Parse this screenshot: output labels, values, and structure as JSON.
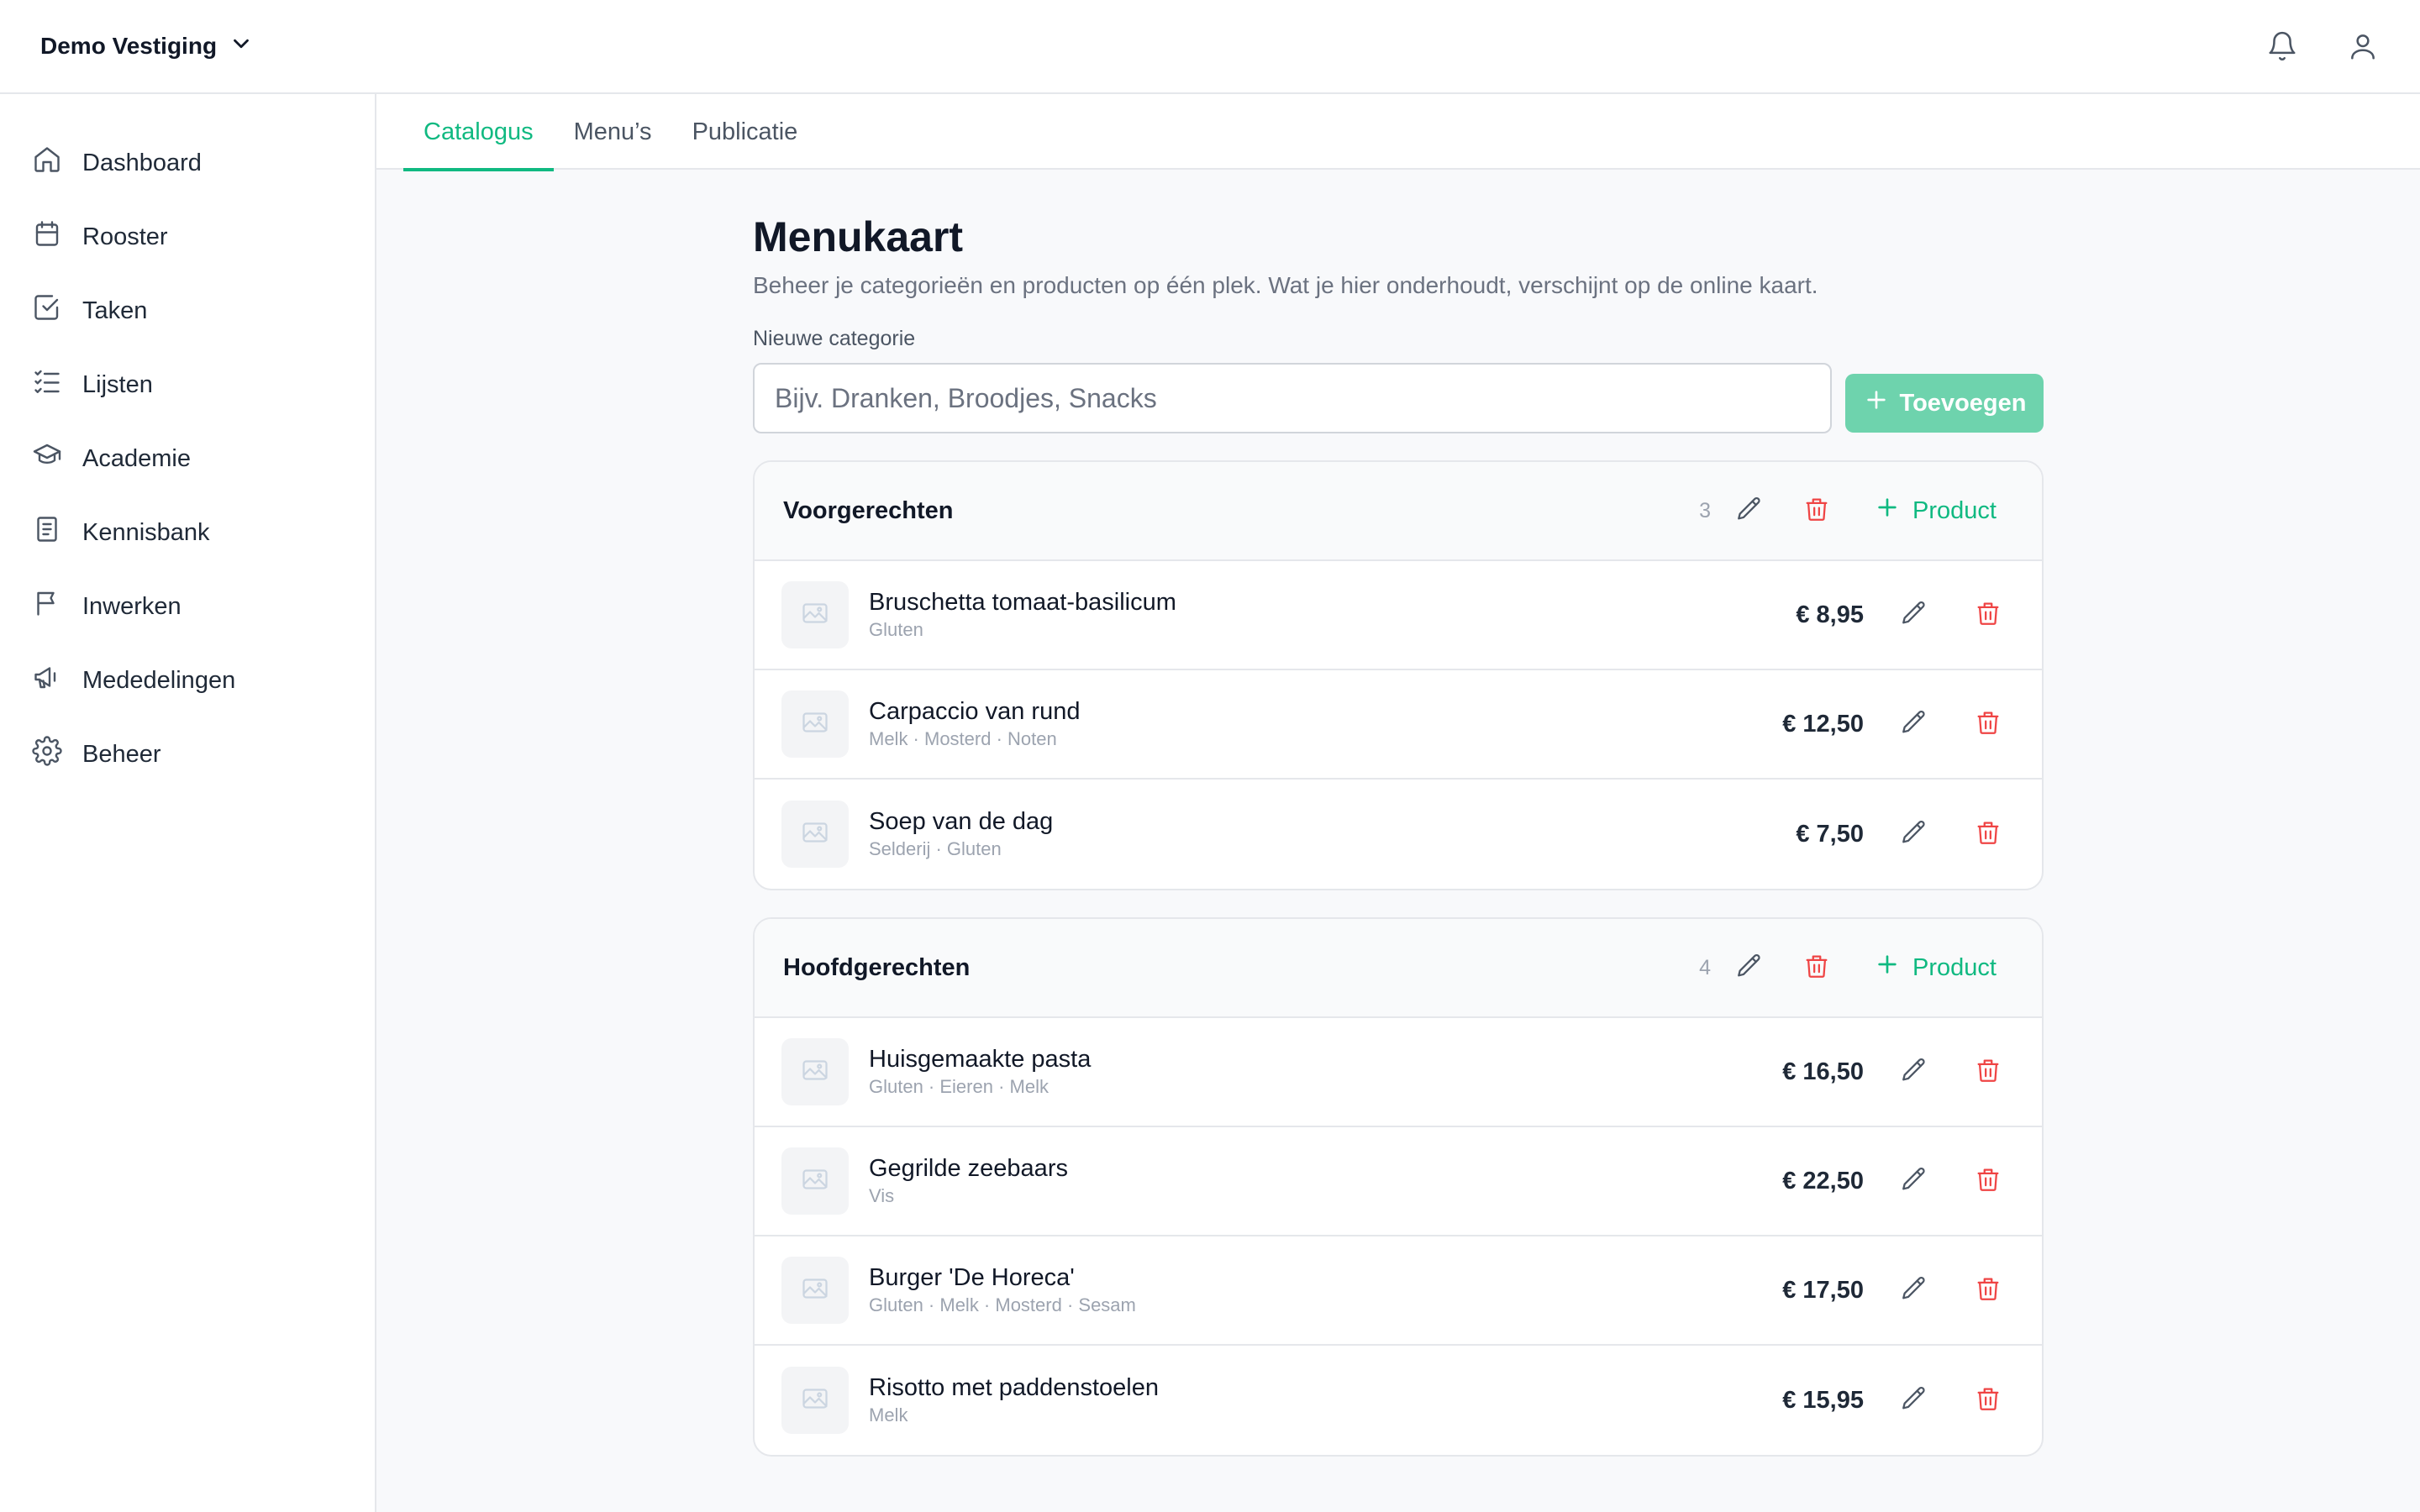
{
  "header": {
    "branch_name": "Demo Vestiging"
  },
  "sidebar": {
    "items": [
      {
        "label": "Dashboard"
      },
      {
        "label": "Rooster"
      },
      {
        "label": "Taken"
      },
      {
        "label": "Lijsten"
      },
      {
        "label": "Academie"
      },
      {
        "label": "Kennisbank"
      },
      {
        "label": "Inwerken"
      },
      {
        "label": "Mededelingen"
      },
      {
        "label": "Beheer"
      }
    ]
  },
  "tabs": [
    {
      "label": "Catalogus",
      "active": true
    },
    {
      "label": "Menu’s"
    },
    {
      "label": "Publicatie"
    }
  ],
  "main": {
    "title": "Menukaart",
    "subtitle": "Beheer je categorieën en producten op één plek. Wat je hier onderhoudt, verschijnt op de online kaart.",
    "new_category_label": "Nieuwe categorie",
    "new_category_placeholder": "Bijv. Dranken, Broodjes, Snacks",
    "add_button": "Toevoegen",
    "product_button": "Product",
    "categories": [
      {
        "name": "Voorgerechten",
        "count": "3",
        "products": [
          {
            "name": "Bruschetta tomaat-basilicum",
            "tags": "Gluten",
            "price": "€ 8,95"
          },
          {
            "name": "Carpaccio van rund",
            "tags": "Melk · Mosterd · Noten",
            "price": "€ 12,50"
          },
          {
            "name": "Soep van de dag",
            "tags": "Selderij · Gluten",
            "price": "€ 7,50"
          }
        ]
      },
      {
        "name": "Hoofdgerechten",
        "count": "4",
        "products": [
          {
            "name": "Huisgemaakte pasta",
            "tags": "Gluten · Eieren · Melk",
            "price": "€ 16,50"
          },
          {
            "name": "Gegrilde zeebaars",
            "tags": "Vis",
            "price": "€ 22,50"
          },
          {
            "name": "Burger 'De Horeca'",
            "tags": "Gluten · Melk · Mosterd · Sesam",
            "price": "€ 17,50"
          },
          {
            "name": "Risotto met paddenstoelen",
            "tags": "Melk",
            "price": "€ 15,95"
          }
        ]
      }
    ]
  },
  "colors": {
    "accent": "#10b981",
    "accent_light": "#6ed3ad",
    "danger": "#ef4444"
  },
  "icons": [
    "chevron-down-icon",
    "bell-icon",
    "user-icon",
    "home-icon",
    "calendar-icon",
    "check-square-icon",
    "list-icon",
    "graduation-cap-icon",
    "book-icon",
    "flag-icon",
    "megaphone-icon",
    "gear-icon",
    "plus-icon",
    "pencil-icon",
    "trash-icon",
    "image-icon"
  ]
}
